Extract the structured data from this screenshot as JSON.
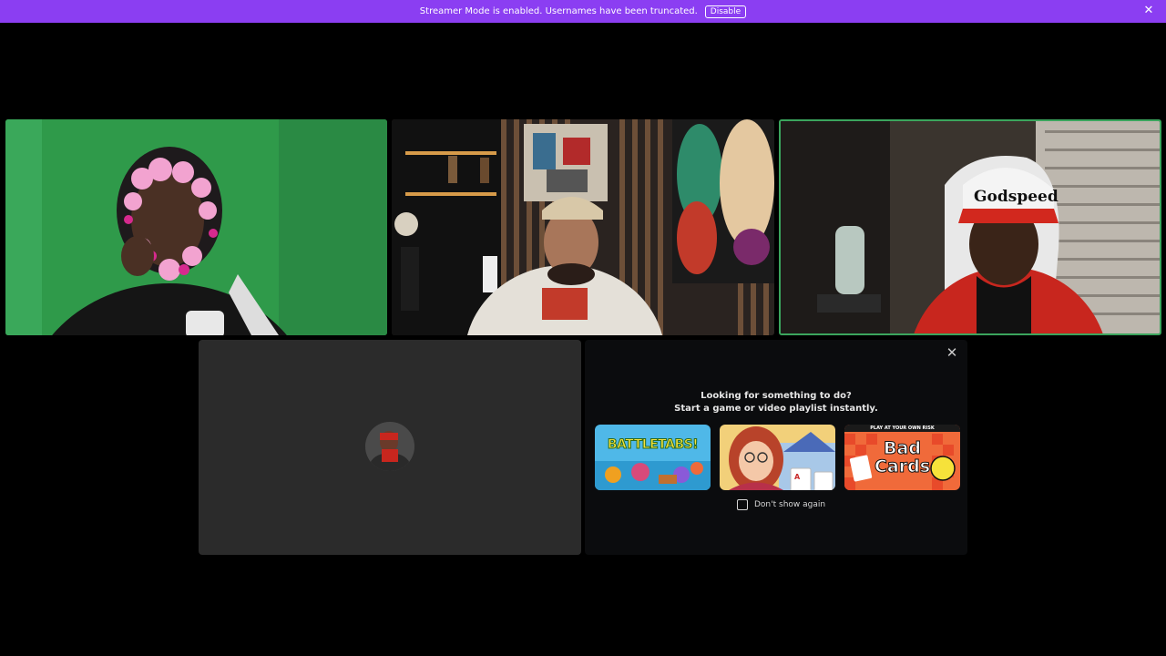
{
  "banner": {
    "message": "Streamer Mode is enabled. Usernames have been truncated.",
    "disable_label": "Disable",
    "close_glyph": "✕",
    "background": "#8b3ef2"
  },
  "video_tiles": [
    {
      "id": "participant-1",
      "speaking": false
    },
    {
      "id": "participant-2",
      "speaking": false
    },
    {
      "id": "participant-3",
      "speaking": true,
      "speaking_border": "#3ba55d"
    }
  ],
  "activity_panel": {
    "close_glyph": "✕",
    "line1": "Looking for something to do?",
    "line2": "Start a game or video playlist instantly.",
    "activities": [
      {
        "title": "BATTLETABS!",
        "icon": "battletabs-art"
      },
      {
        "title": "",
        "icon": "card-game-art"
      },
      {
        "title": "Bad Cards",
        "header": "PLAY AT YOUR OWN RISK",
        "icon": "bad-cards-art"
      }
    ],
    "dont_show_label": "Don't show again",
    "dont_show_checked": false
  }
}
